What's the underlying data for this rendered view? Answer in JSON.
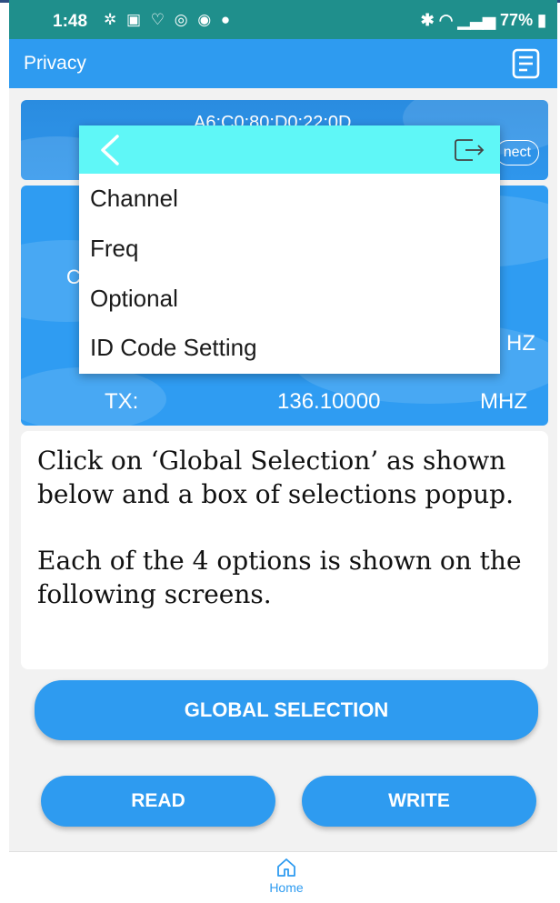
{
  "status_bar": {
    "time": "1:48",
    "left_icons": [
      "settings-icon",
      "image-icon",
      "shield-icon",
      "vpn-icon",
      "shield-icon",
      "messenger-icon"
    ],
    "right_text": "✱ ▲ ▁▃▅ 77%▮",
    "battery": "77%"
  },
  "app_bar": {
    "title": "Privacy",
    "right_icon": "notes-icon"
  },
  "device_card": {
    "mac_text": "A6:C0:80:D0:22:0D",
    "connect_label": "nect"
  },
  "freq_card": {
    "partial_c1": "C",
    "partial_c2": "C",
    "partial_hz": "HZ",
    "tx_label": "TX:",
    "tx_value": "136.10000",
    "tx_unit": "MHZ"
  },
  "instructions": {
    "paragraph1": "Click on ‘Global Selection’  as shown below and a box of selections popup.",
    "paragraph2": "Each of the 4 options is shown on the following screens."
  },
  "buttons": {
    "global": "GLOBAL SELECTION",
    "read": "READ",
    "write": "WRITE"
  },
  "bottom_nav": {
    "home": "Home"
  },
  "popup_menu": {
    "items": [
      "Channel",
      "Freq",
      "Optional",
      "ID Code Setting"
    ]
  },
  "colors": {
    "primary": "#2e9bf0",
    "popup_header": "#5ff7f7",
    "status_bar": "#1f8f8c"
  }
}
